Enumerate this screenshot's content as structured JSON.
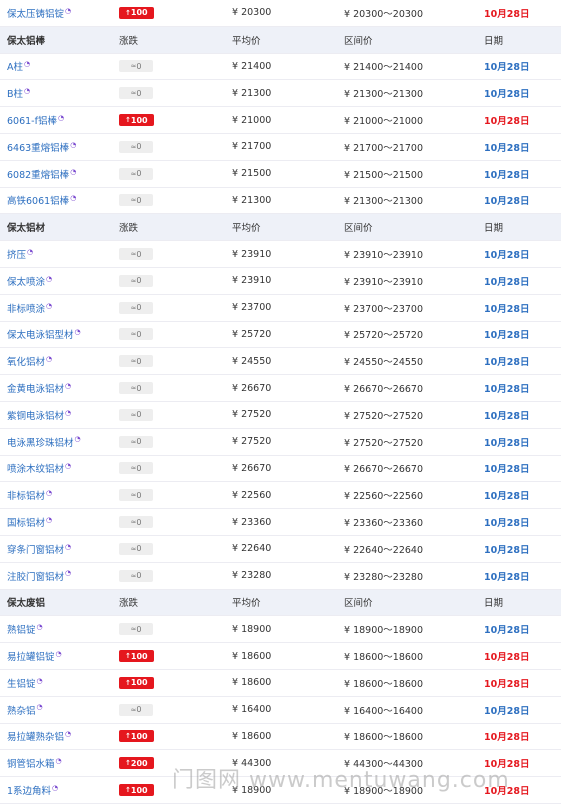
{
  "watermark": "门图网 www.mentuwang.com",
  "rows": [
    {
      "kind": "item",
      "name": "保太压铸铝锭",
      "chg": "100",
      "dir": "up",
      "avg": "¥  20300",
      "range": "¥  20300～20300",
      "date": "10月28日",
      "date_color": "red"
    },
    {
      "kind": "header",
      "name": "保太铝棒",
      "chg": "涨跌",
      "avg": "平均价",
      "range": "区间价",
      "date": "日期"
    },
    {
      "kind": "item",
      "name": "A柱",
      "chg": "0",
      "dir": "flat",
      "avg": "¥  21400",
      "range": "¥  21400～21400",
      "date": "10月28日",
      "date_color": "blue"
    },
    {
      "kind": "item",
      "name": "B柱",
      "chg": "0",
      "dir": "flat",
      "avg": "¥  21300",
      "range": "¥  21300～21300",
      "date": "10月28日",
      "date_color": "blue"
    },
    {
      "kind": "item",
      "name": "6061-f铝棒",
      "chg": "100",
      "dir": "up",
      "avg": "¥  21000",
      "range": "¥  21000～21000",
      "date": "10月28日",
      "date_color": "red"
    },
    {
      "kind": "item",
      "name": "6463重熔铝棒",
      "chg": "0",
      "dir": "flat",
      "avg": "¥  21700",
      "range": "¥  21700～21700",
      "date": "10月28日",
      "date_color": "blue"
    },
    {
      "kind": "item",
      "name": "6082重熔铝棒",
      "chg": "0",
      "dir": "flat",
      "avg": "¥  21500",
      "range": "¥  21500～21500",
      "date": "10月28日",
      "date_color": "blue"
    },
    {
      "kind": "item",
      "name": "高铁6061铝棒",
      "chg": "0",
      "dir": "flat",
      "avg": "¥  21300",
      "range": "¥  21300～21300",
      "date": "10月28日",
      "date_color": "blue"
    },
    {
      "kind": "header",
      "name": "保太铝材",
      "chg": "涨跌",
      "avg": "平均价",
      "range": "区间价",
      "date": "日期"
    },
    {
      "kind": "item",
      "name": "挤压",
      "chg": "0",
      "dir": "flat",
      "avg": "¥  23910",
      "range": "¥  23910～23910",
      "date": "10月28日",
      "date_color": "blue"
    },
    {
      "kind": "item",
      "name": "保太喷涂",
      "chg": "0",
      "dir": "flat",
      "avg": "¥  23910",
      "range": "¥  23910～23910",
      "date": "10月28日",
      "date_color": "blue"
    },
    {
      "kind": "item",
      "name": "非标喷涂",
      "chg": "0",
      "dir": "flat",
      "avg": "¥  23700",
      "range": "¥  23700～23700",
      "date": "10月28日",
      "date_color": "blue"
    },
    {
      "kind": "item",
      "name": "保太电泳铝型材",
      "chg": "0",
      "dir": "flat",
      "avg": "¥  25720",
      "range": "¥  25720～25720",
      "date": "10月28日",
      "date_color": "blue"
    },
    {
      "kind": "item",
      "name": "氧化铝材",
      "chg": "0",
      "dir": "flat",
      "avg": "¥  24550",
      "range": "¥  24550～24550",
      "date": "10月28日",
      "date_color": "blue"
    },
    {
      "kind": "item",
      "name": "金黄电泳铝材",
      "chg": "0",
      "dir": "flat",
      "avg": "¥  26670",
      "range": "¥  26670～26670",
      "date": "10月28日",
      "date_color": "blue"
    },
    {
      "kind": "item",
      "name": "紫铜电泳铝材",
      "chg": "0",
      "dir": "flat",
      "avg": "¥  27520",
      "range": "¥  27520～27520",
      "date": "10月28日",
      "date_color": "blue"
    },
    {
      "kind": "item",
      "name": "电泳黑珍珠铝材",
      "chg": "0",
      "dir": "flat",
      "avg": "¥  27520",
      "range": "¥  27520～27520",
      "date": "10月28日",
      "date_color": "blue"
    },
    {
      "kind": "item",
      "name": "喷涂木纹铝材",
      "chg": "0",
      "dir": "flat",
      "avg": "¥  26670",
      "range": "¥  26670～26670",
      "date": "10月28日",
      "date_color": "blue"
    },
    {
      "kind": "item",
      "name": "非标铝材",
      "chg": "0",
      "dir": "flat",
      "avg": "¥  22560",
      "range": "¥  22560～22560",
      "date": "10月28日",
      "date_color": "blue"
    },
    {
      "kind": "item",
      "name": "国标铝材",
      "chg": "0",
      "dir": "flat",
      "avg": "¥  23360",
      "range": "¥  23360～23360",
      "date": "10月28日",
      "date_color": "blue"
    },
    {
      "kind": "item",
      "name": "穿条门窗铝材",
      "chg": "0",
      "dir": "flat",
      "avg": "¥  22640",
      "range": "¥  22640～22640",
      "date": "10月28日",
      "date_color": "blue"
    },
    {
      "kind": "item",
      "name": "注胶门窗铝材",
      "chg": "0",
      "dir": "flat",
      "avg": "¥  23280",
      "range": "¥  23280～23280",
      "date": "10月28日",
      "date_color": "blue"
    },
    {
      "kind": "header",
      "name": "保太废铝",
      "chg": "涨跌",
      "avg": "平均价",
      "range": "区间价",
      "date": "日期"
    },
    {
      "kind": "item",
      "name": "熟铝锭",
      "chg": "0",
      "dir": "flat",
      "avg": "¥  18900",
      "range": "¥  18900～18900",
      "date": "10月28日",
      "date_color": "blue"
    },
    {
      "kind": "item",
      "name": "易拉罐铝锭",
      "chg": "100",
      "dir": "up",
      "avg": "¥  18600",
      "range": "¥  18600～18600",
      "date": "10月28日",
      "date_color": "red"
    },
    {
      "kind": "item",
      "name": "生铝锭",
      "chg": "100",
      "dir": "up",
      "avg": "¥  18600",
      "range": "¥  18600～18600",
      "date": "10月28日",
      "date_color": "red"
    },
    {
      "kind": "item",
      "name": "熟杂铝",
      "chg": "0",
      "dir": "flat",
      "avg": "¥  16400",
      "range": "¥  16400～16400",
      "date": "10月28日",
      "date_color": "blue"
    },
    {
      "kind": "item",
      "name": "易拉罐熟杂铝",
      "chg": "100",
      "dir": "up",
      "avg": "¥  18600",
      "range": "¥  18600～18600",
      "date": "10月28日",
      "date_color": "red"
    },
    {
      "kind": "item",
      "name": "铜管铝水箱",
      "chg": "200",
      "dir": "up",
      "avg": "¥  44300",
      "range": "¥  44300～44300",
      "date": "10月28日",
      "date_color": "red"
    },
    {
      "kind": "item",
      "name": "1系边角料",
      "chg": "100",
      "dir": "up",
      "avg": "¥  18900",
      "range": "¥  18900～18900",
      "date": "10月28日",
      "date_color": "red"
    }
  ],
  "icons": {
    "up": "arrow-up-icon",
    "flat": "flat-trend-icon",
    "tag": "verified-tag-icon"
  },
  "colors": {
    "up": "#e5171e",
    "link": "#2d6fc0",
    "header_bg": "#eef1f8",
    "flat_bg": "#eeeeee"
  }
}
